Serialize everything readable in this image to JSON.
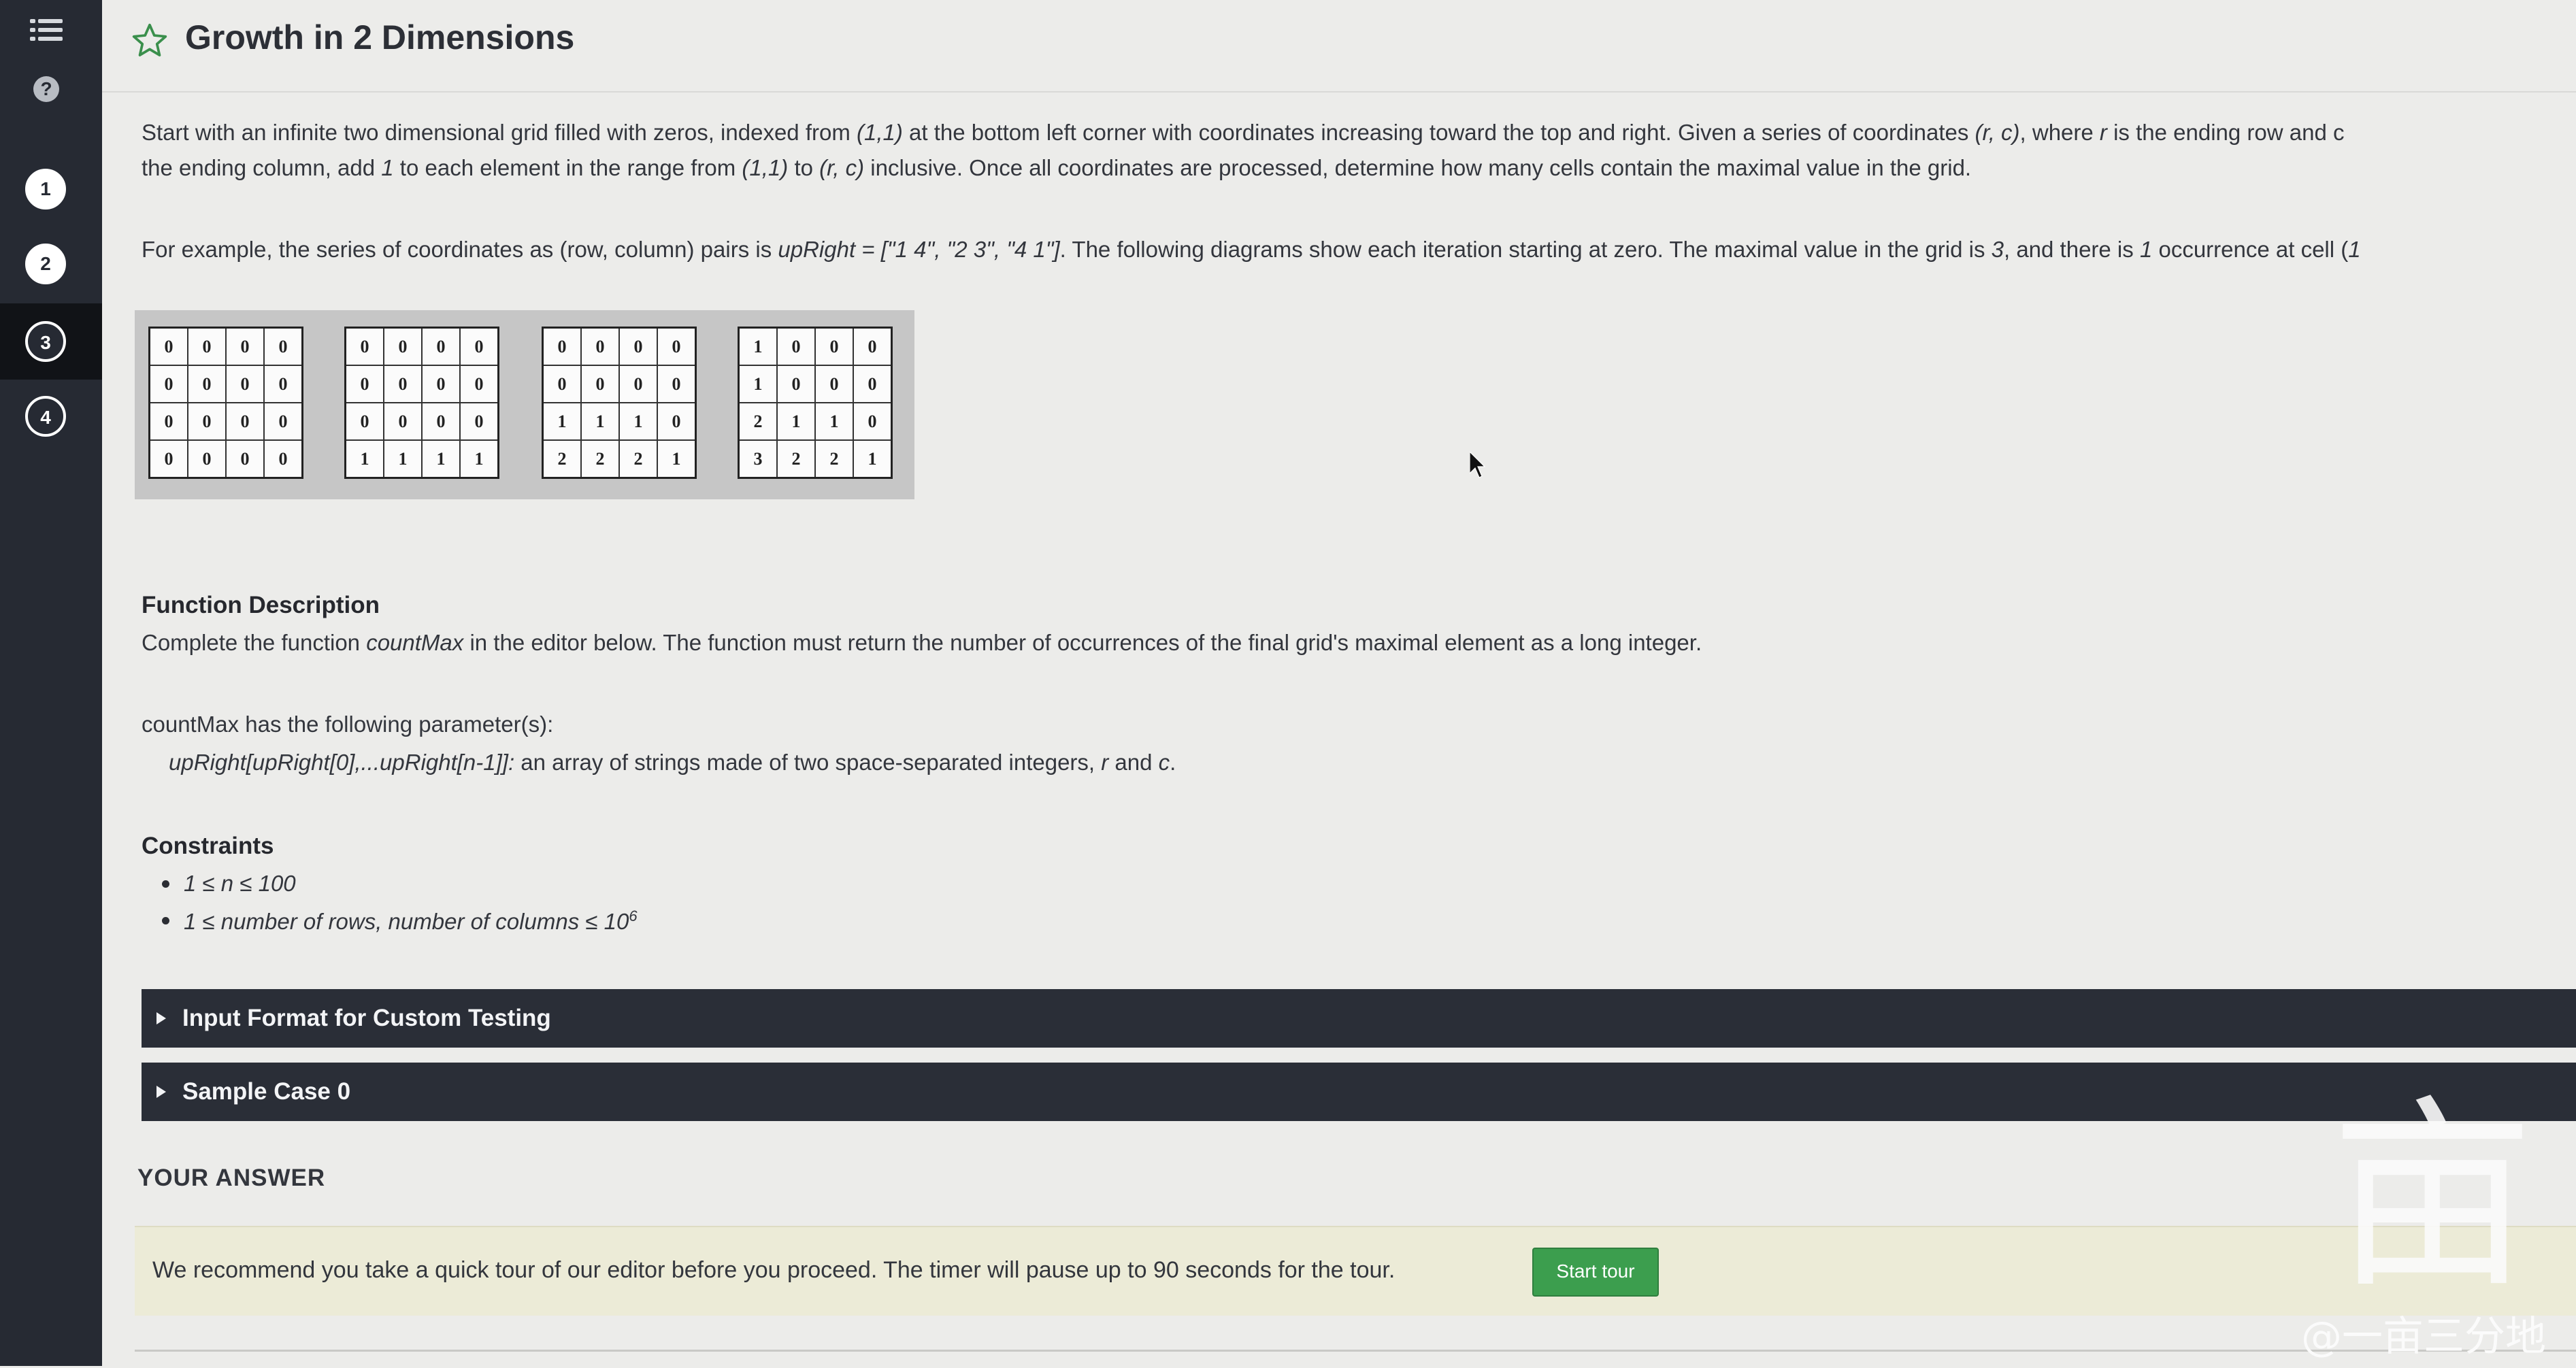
{
  "sidebar": {
    "help_label": "?",
    "questions": [
      "1",
      "2",
      "3",
      "4"
    ]
  },
  "header": {
    "title": "Growth in 2 Dimensions"
  },
  "statement": {
    "line1_a": "Start with an infinite two dimensional grid filled with zeros, indexed from ",
    "line1_b": "(1,1)",
    "line1_c": " at the bottom left corner with coordinates increasing toward the top and right. Given a series of coordinates ",
    "line1_d": "(r, c)",
    "line1_e": ", where ",
    "line1_f": "r",
    "line1_g": " is the ending row and c",
    "line2_a": "the ending column, add ",
    "line2_b": "1",
    "line2_c": " to each element in the range from ",
    "line2_d": "(1,1)",
    "line2_e": " to ",
    "line2_f": "(r, c)",
    "line2_g": " inclusive. Once all coordinates are processed, determine how many cells contain the maximal value in the grid.",
    "example_a": "For example, the series of coordinates as (row, column) pairs is ",
    "example_b": "upRight",
    "example_c": " = [\"1 4\", \"2 3\", \"4 1\"]",
    "example_d": ". The following diagrams show each iteration starting at zero. The maximal value in the grid is ",
    "example_e": "3",
    "example_f": ", and there is ",
    "example_g": "1",
    "example_h": " occurrence at cell (",
    "example_i": "1"
  },
  "grids": [
    [
      [
        "0",
        "0",
        "0",
        "0"
      ],
      [
        "0",
        "0",
        "0",
        "0"
      ],
      [
        "0",
        "0",
        "0",
        "0"
      ],
      [
        "0",
        "0",
        "0",
        "0"
      ]
    ],
    [
      [
        "0",
        "0",
        "0",
        "0"
      ],
      [
        "0",
        "0",
        "0",
        "0"
      ],
      [
        "0",
        "0",
        "0",
        "0"
      ],
      [
        "1",
        "1",
        "1",
        "1"
      ]
    ],
    [
      [
        "0",
        "0",
        "0",
        "0"
      ],
      [
        "0",
        "0",
        "0",
        "0"
      ],
      [
        "1",
        "1",
        "1",
        "0"
      ],
      [
        "2",
        "2",
        "2",
        "1"
      ]
    ],
    [
      [
        "1",
        "0",
        "0",
        "0"
      ],
      [
        "1",
        "0",
        "0",
        "0"
      ],
      [
        "2",
        "1",
        "1",
        "0"
      ],
      [
        "3",
        "2",
        "2",
        "1"
      ]
    ]
  ],
  "function_description": {
    "heading": "Function Description",
    "text_a": "Complete the function ",
    "text_b": "countMax",
    "text_c": " in the editor below. The function must return the number of occurrences of the final grid's maximal element as a long integer.",
    "params_heading": "countMax has the following parameter(s):",
    "param_name": "upRight[upRight[0],...upRight[n-1]]:",
    "param_desc_a": "  an array of strings made of two space-separated integers, ",
    "param_desc_b": "r",
    "param_desc_c": " and ",
    "param_desc_d": "c",
    "param_desc_e": "."
  },
  "constraints": {
    "heading": "Constraints",
    "item1": "1 ≤ n ≤ 100",
    "item2": "1 ≤ number of rows, number of columns ≤ 10",
    "item2_sup": "6"
  },
  "accordions": [
    "Input Format for Custom Testing",
    "Sample Case 0"
  ],
  "answer": {
    "heading": "YOUR ANSWER",
    "tour_text": "We recommend you take a quick tour of our editor before you proceed. The timer will pause up to 90 seconds for the tour.",
    "tour_button": "Start tour"
  },
  "watermark": {
    "glyph": "亩",
    "text": "@一亩三分地"
  }
}
